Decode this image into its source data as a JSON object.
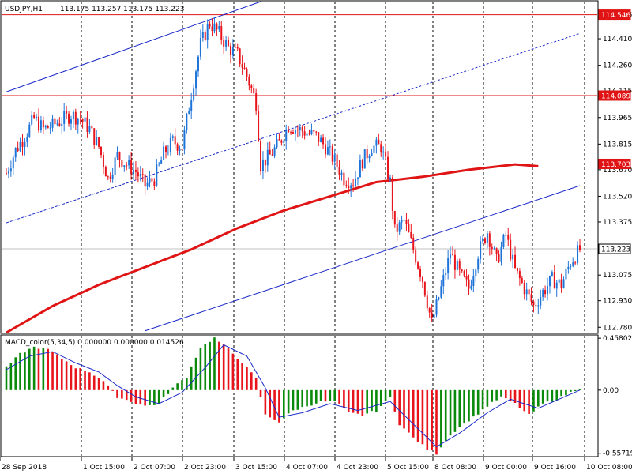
{
  "header": {
    "symbol_tf": "USDJPY,H1",
    "ohlc": "113.175 113.257 113.175 113.223"
  },
  "macd_header": {
    "label": "MACD_color(5,34,5) 0.000000 0.000000 0.014526"
  },
  "colors": {
    "bull": "#1e73d8",
    "bear": "#e8141c",
    "ma": "#e01414",
    "channel": "#1a28c8",
    "hline": "#e01414",
    "macd_pos": "#0a8a0a",
    "macd_neg": "#e8141c",
    "signal": "#1a28c8",
    "grid": "#000000"
  },
  "chart_data": [
    {
      "type": "candlestick",
      "title": "USDJPY,H1",
      "ylim": [
        112.75,
        114.62
      ],
      "x_ticks": [
        "28 Sep 2018",
        "1 Oct 15:00",
        "2 Oct 07:00",
        "2 Oct 23:00",
        "3 Oct 15:00",
        "4 Oct 07:00",
        "4 Oct 23:00",
        "5 Oct 15:00",
        "8 Oct 08:00",
        "9 Oct 00:00",
        "9 Oct 16:00",
        "10 Oct 08:00"
      ],
      "y_ticks": [
        114.546,
        114.41,
        114.26,
        114.115,
        113.965,
        113.815,
        113.67,
        113.52,
        113.375,
        113.075,
        112.93,
        112.78
      ],
      "y_tick_labels": [
        "114.546",
        "114.410",
        "114.260",
        "114.115",
        "113.965",
        "113.815",
        "113.670",
        "113.520",
        "113.375",
        "113.075",
        "112.930",
        "112.780"
      ],
      "level_labels": [
        {
          "value": 114.546,
          "label": "114.546"
        },
        {
          "value": 114.089,
          "label": "114.089"
        },
        {
          "value": 113.703,
          "label": "113.703"
        },
        {
          "value": 113.223,
          "label": "113.223"
        }
      ],
      "horizontal_levels": [
        114.546,
        114.089,
        113.703
      ],
      "current_price": 113.223,
      "close_path": [
        [
          0,
          113.65
        ],
        [
          4,
          113.78
        ],
        [
          8,
          113.86
        ],
        [
          12,
          113.96
        ],
        [
          16,
          113.9
        ],
        [
          20,
          113.92
        ],
        [
          24,
          113.95
        ],
        [
          28,
          113.98
        ],
        [
          32,
          113.96
        ],
        [
          36,
          113.9
        ],
        [
          40,
          113.8
        ],
        [
          44,
          113.62
        ],
        [
          48,
          113.75
        ],
        [
          52,
          113.7
        ],
        [
          56,
          113.66
        ],
        [
          60,
          113.58
        ],
        [
          64,
          113.62
        ],
        [
          68,
          113.76
        ],
        [
          72,
          113.83
        ],
        [
          76,
          113.8
        ],
        [
          80,
          114.1
        ],
        [
          84,
          114.38
        ],
        [
          88,
          114.5
        ],
        [
          92,
          114.44
        ],
        [
          96,
          114.36
        ],
        [
          100,
          114.32
        ],
        [
          104,
          114.2
        ],
        [
          108,
          114.05
        ],
        [
          110,
          113.7
        ],
        [
          114,
          113.75
        ],
        [
          118,
          113.82
        ],
        [
          122,
          113.92
        ],
        [
          126,
          113.9
        ],
        [
          130,
          113.88
        ],
        [
          134,
          113.86
        ],
        [
          138,
          113.8
        ],
        [
          142,
          113.72
        ],
        [
          146,
          113.62
        ],
        [
          150,
          113.6
        ],
        [
          154,
          113.72
        ],
        [
          158,
          113.8
        ],
        [
          162,
          113.8
        ],
        [
          166,
          113.6
        ],
        [
          168,
          113.32
        ],
        [
          172,
          113.38
        ],
        [
          176,
          113.22
        ],
        [
          180,
          113.05
        ],
        [
          184,
          112.8
        ],
        [
          188,
          113.0
        ],
        [
          192,
          113.2
        ],
        [
          196,
          113.08
        ],
        [
          200,
          113.0
        ],
        [
          204,
          113.2
        ],
        [
          208,
          113.32
        ],
        [
          212,
          113.15
        ],
        [
          216,
          113.3
        ],
        [
          220,
          113.1
        ],
        [
          224,
          113.0
        ],
        [
          228,
          112.9
        ],
        [
          232,
          112.98
        ],
        [
          236,
          113.05
        ],
        [
          240,
          113.02
        ],
        [
          244,
          113.15
        ],
        [
          248,
          113.22
        ]
      ],
      "ma_path": [
        [
          0,
          112.75
        ],
        [
          20,
          112.9
        ],
        [
          40,
          113.02
        ],
        [
          60,
          113.12
        ],
        [
          80,
          113.22
        ],
        [
          100,
          113.34
        ],
        [
          120,
          113.44
        ],
        [
          140,
          113.52
        ],
        [
          160,
          113.6
        ],
        [
          180,
          113.63
        ],
        [
          200,
          113.67
        ],
        [
          220,
          113.7
        ],
        [
          230,
          113.69
        ]
      ],
      "channels": [
        {
          "style": "solid",
          "from": [
            0,
            114.11
          ],
          "to": [
            110,
            114.62
          ]
        },
        {
          "style": "solid",
          "from": [
            60,
            112.76
          ],
          "to": [
            248,
            113.58
          ]
        },
        {
          "style": "dashed",
          "from": [
            0,
            113.37
          ],
          "to": [
            248,
            114.44
          ]
        }
      ]
    },
    {
      "type": "bar",
      "title": "MACD_color(5,34,5)",
      "ylim": [
        -0.58,
        0.48
      ],
      "y_tick_labels": [
        "0.458027",
        "0.00",
        "-0.557194"
      ],
      "y_ticks": [
        0.458027,
        0,
        -0.557194
      ],
      "histogram_path": [
        [
          0,
          0.2
        ],
        [
          6,
          0.32
        ],
        [
          12,
          0.38
        ],
        [
          18,
          0.36
        ],
        [
          24,
          0.28
        ],
        [
          30,
          0.2
        ],
        [
          36,
          0.16
        ],
        [
          42,
          0.08
        ],
        [
          48,
          -0.06
        ],
        [
          54,
          -0.1
        ],
        [
          60,
          -0.14
        ],
        [
          66,
          -0.12
        ],
        [
          72,
          0.02
        ],
        [
          78,
          0.12
        ],
        [
          84,
          0.38
        ],
        [
          90,
          0.46
        ],
        [
          96,
          0.36
        ],
        [
          102,
          0.25
        ],
        [
          108,
          0.1
        ],
        [
          112,
          -0.22
        ],
        [
          118,
          -0.28
        ],
        [
          124,
          -0.18
        ],
        [
          130,
          -0.14
        ],
        [
          136,
          -0.1
        ],
        [
          142,
          -0.1
        ],
        [
          148,
          -0.2
        ],
        [
          154,
          -0.22
        ],
        [
          160,
          -0.18
        ],
        [
          166,
          -0.06
        ],
        [
          170,
          -0.3
        ],
        [
          176,
          -0.42
        ],
        [
          182,
          -0.52
        ],
        [
          186,
          -0.56
        ],
        [
          190,
          -0.44
        ],
        [
          196,
          -0.32
        ],
        [
          202,
          -0.24
        ],
        [
          208,
          -0.14
        ],
        [
          214,
          -0.06
        ],
        [
          220,
          -0.12
        ],
        [
          226,
          -0.22
        ],
        [
          232,
          -0.12
        ],
        [
          238,
          -0.08
        ],
        [
          244,
          -0.02
        ],
        [
          248,
          0.02
        ]
      ],
      "signal_path": [
        [
          0,
          0.18
        ],
        [
          10,
          0.3
        ],
        [
          20,
          0.34
        ],
        [
          30,
          0.24
        ],
        [
          40,
          0.16
        ],
        [
          48,
          0.04
        ],
        [
          56,
          -0.06
        ],
        [
          66,
          -0.12
        ],
        [
          76,
          -0.02
        ],
        [
          86,
          0.2
        ],
        [
          94,
          0.4
        ],
        [
          104,
          0.3
        ],
        [
          112,
          0.02
        ],
        [
          118,
          -0.24
        ],
        [
          128,
          -0.2
        ],
        [
          140,
          -0.12
        ],
        [
          152,
          -0.18
        ],
        [
          166,
          -0.1
        ],
        [
          176,
          -0.3
        ],
        [
          186,
          -0.5
        ],
        [
          196,
          -0.38
        ],
        [
          208,
          -0.2
        ],
        [
          218,
          -0.08
        ],
        [
          230,
          -0.16
        ],
        [
          248,
          0.0
        ]
      ]
    }
  ]
}
